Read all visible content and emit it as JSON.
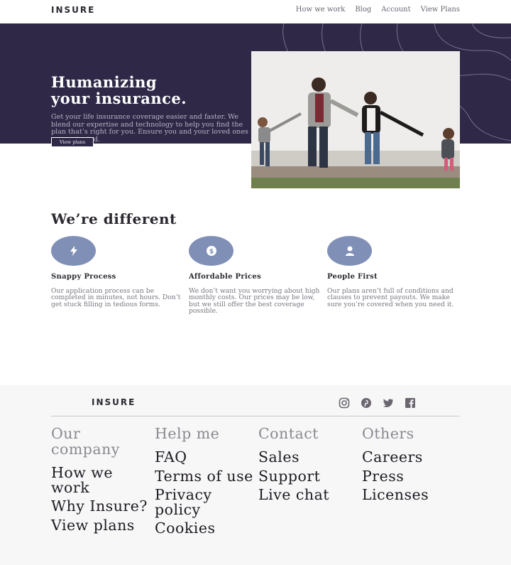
{
  "brand": {
    "logo": "INSURE"
  },
  "nav": {
    "items": [
      "How we work",
      "Blog",
      "Account",
      "View Plans"
    ]
  },
  "hero": {
    "title_line1": "Humanizing",
    "title_line2": "your insurance.",
    "text": "Get your life insurance coverage easier and faster. We blend our expertise and technology to help you find the plan that’s right for you. Ensure you and your loved ones are protected.",
    "button_label": "View plans"
  },
  "features": {
    "heading": "We’re different",
    "items": [
      {
        "icon": "lightning-icon",
        "title": "Snappy Process",
        "text": "Our application process can be completed in minutes, not hours. Don’t get stuck filling in tedious forms."
      },
      {
        "icon": "dollar-icon",
        "title": "Affordable Prices",
        "text": "We don’t want you worrying about high monthly costs. Our prices may be low, but we still offer the best coverage possible."
      },
      {
        "icon": "person-icon",
        "title": "People First",
        "text": "Our plans aren’t full of conditions and clauses to prevent payouts. We make sure you’re covered when you need it."
      }
    ]
  },
  "footer": {
    "logo": "INSURE",
    "socials": [
      "instagram-icon",
      "pinterest-icon",
      "twitter-icon",
      "facebook-icon"
    ],
    "columns": [
      {
        "heading": "Our company",
        "links": [
          "How we work",
          "Why Insure?",
          "View plans"
        ]
      },
      {
        "heading": "Help me",
        "links": [
          "FAQ",
          "Terms of use",
          "Privacy policy",
          "Cookies"
        ]
      },
      {
        "heading": "Contact",
        "links": [
          "Sales",
          "Support",
          "Live chat"
        ]
      },
      {
        "heading": "Others",
        "links": [
          "Careers",
          "Press",
          "Licenses"
        ]
      }
    ]
  },
  "colors": {
    "hero_bg": "#2f2947",
    "accent": "#7f8fb6",
    "footer_bg": "#f7f7f8"
  }
}
